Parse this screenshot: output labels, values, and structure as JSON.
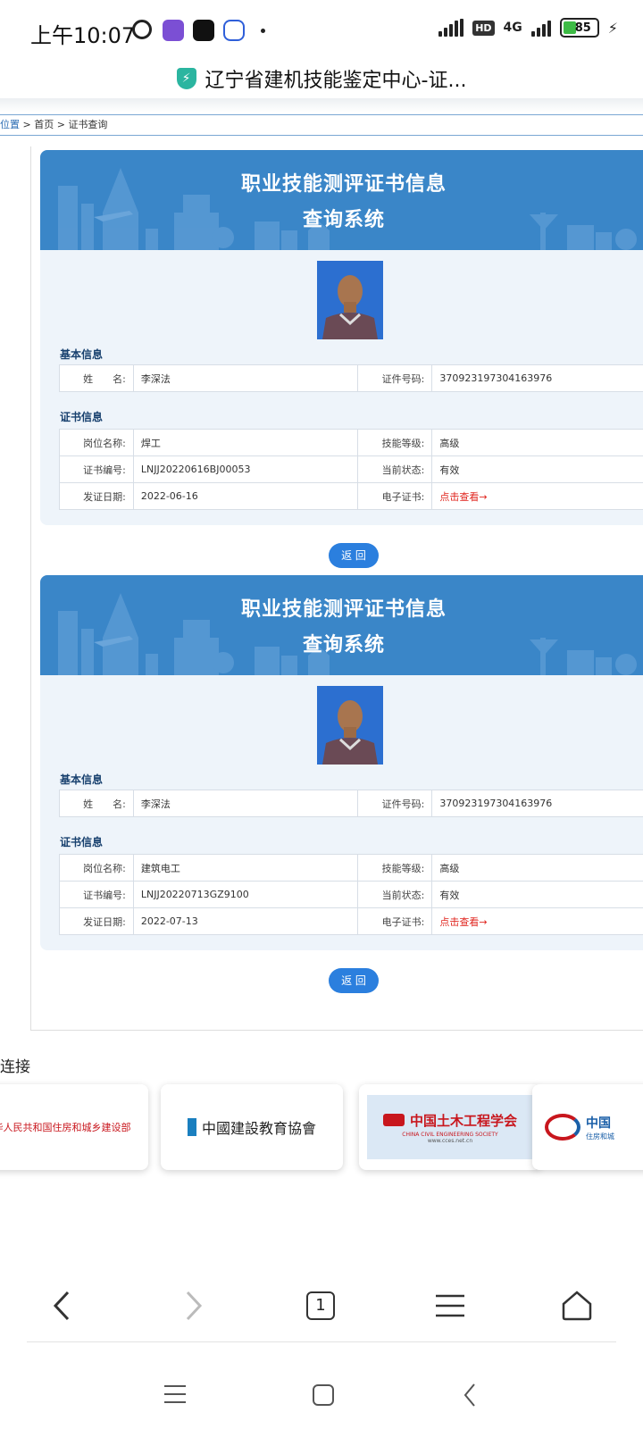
{
  "status": {
    "time": "上午10:07",
    "network": "4G",
    "battery": "85",
    "hd": "HD"
  },
  "browser": {
    "page_title": "辽宁省建机技能鉴定中心-证...",
    "tab_count": "1"
  },
  "breadcrumb": {
    "position": "位置",
    "sep1": " > ",
    "home": "首页",
    "sep2": " > ",
    "current": "证书查询"
  },
  "certificates": [
    {
      "banner_line1": "职业技能测评证书信息",
      "banner_line2": "查询系统",
      "basic_label": "基本信息",
      "cert_label": "证书信息",
      "name_key": "姓　　名:",
      "name": "李深法",
      "id_key": "证件号码:",
      "id_number": "370923197304163976",
      "job_key": "岗位名称:",
      "job": "焊工",
      "level_key": "技能等级:",
      "level": "高级",
      "cert_no_key": "证书编号:",
      "cert_no": "LNJJ20220616BJ00053",
      "state_key": "当前状态:",
      "state": "有效",
      "date_key": "发证日期:",
      "date": "2022-06-16",
      "ecert_key": "电子证书:",
      "ecert_link": "点击查看→",
      "return_label": "返 回"
    },
    {
      "banner_line1": "职业技能测评证书信息",
      "banner_line2": "查询系统",
      "basic_label": "基本信息",
      "cert_label": "证书信息",
      "name_key": "姓　　名:",
      "name": "李深法",
      "id_key": "证件号码:",
      "id_number": "370923197304163976",
      "job_key": "岗位名称:",
      "job": "建筑电工",
      "level_key": "技能等级:",
      "level": "高级",
      "cert_no_key": "证书编号:",
      "cert_no": "LNJJ20220713GZ9100",
      "state_key": "当前状态:",
      "state": "有效",
      "date_key": "发证日期:",
      "date": "2022-07-13",
      "ecert_key": "电子证书:",
      "ecert_link": "点击查看→",
      "return_label": "返 回"
    }
  ],
  "links": {
    "title": "连接",
    "items": [
      {
        "label": "中华人民共和国住房和城乡建设部"
      },
      {
        "label": "中國建設教育協會"
      },
      {
        "label": "中国土木工程学会",
        "sub": "CHINA CIVIL ENGINEERING SOCIETY",
        "url_text": "www.cces.net.cn"
      },
      {
        "label": "中国",
        "sub": "住房和城"
      }
    ]
  },
  "colors": {
    "banner": "#3a86c8",
    "accent": "#2b7fde",
    "link_red": "#e0261f"
  }
}
